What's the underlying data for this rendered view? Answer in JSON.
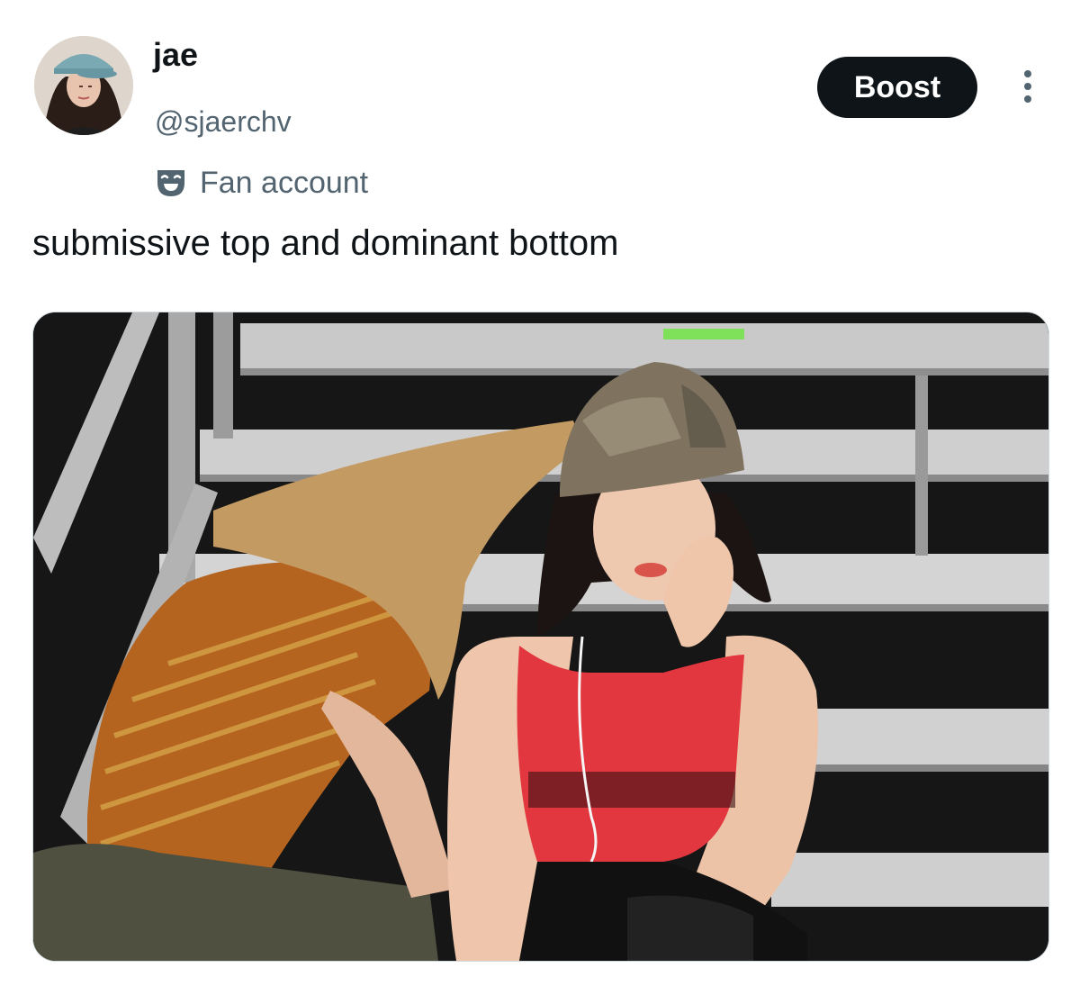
{
  "author": {
    "display_name": "jae",
    "handle": "@sjaerchv",
    "avatar_icon": "profile-photo"
  },
  "actions": {
    "boost_label": "Boost",
    "more_icon": "more-vertical-icon"
  },
  "label": {
    "icon": "theater-masks-icon",
    "text": "Fan account"
  },
  "post": {
    "text": "submissive top and dominant bottom"
  },
  "media": {
    "type": "photo"
  },
  "colors": {
    "primary_text": "#0f1419",
    "secondary_text": "#536471",
    "button_bg": "#0f1419",
    "button_text": "#ffffff"
  }
}
